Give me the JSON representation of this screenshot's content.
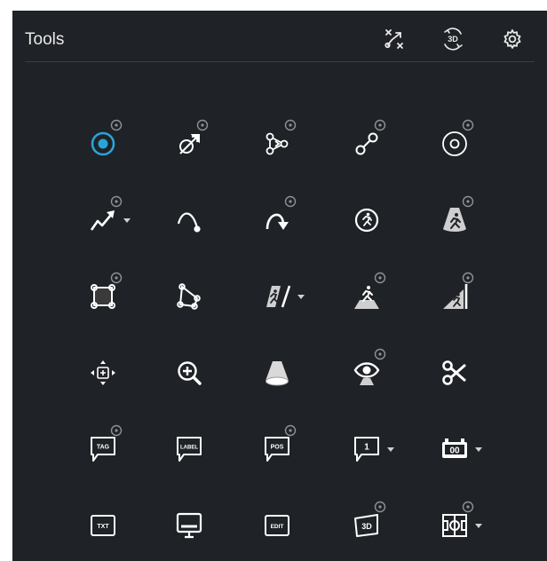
{
  "panel": {
    "title": "Tools",
    "header_icons": [
      "tactical-lines-icon",
      "rotate-3d-icon",
      "gear-icon"
    ]
  },
  "accent_color": "#2aa3d8",
  "tools": [
    {
      "name": "spotlight-point-tool",
      "icon": "target-circle-icon",
      "selected": true,
      "plus": true,
      "caret": false
    },
    {
      "name": "arrow-circle-tool",
      "icon": "circle-arrow-icon",
      "plus": true,
      "caret": false
    },
    {
      "name": "player-connection-tool",
      "icon": "triangle-connect-icon",
      "plus": true,
      "caret": false
    },
    {
      "name": "link-tool",
      "icon": "link-icon",
      "plus": true,
      "caret": false
    },
    {
      "name": "ring-tool",
      "icon": "ring-icon",
      "plus": true,
      "caret": false
    },
    {
      "name": "freehand-arrow-tool",
      "icon": "zigzag-arrow-icon",
      "plus": true,
      "caret": true
    },
    {
      "name": "curve-tool",
      "icon": "curve-icon",
      "plus": false,
      "caret": false
    },
    {
      "name": "curved-arrow-tool",
      "icon": "curved-arrow-icon",
      "plus": true,
      "caret": false
    },
    {
      "name": "player-circle-tool",
      "icon": "runner-circle-icon",
      "plus": false,
      "caret": false
    },
    {
      "name": "player-spotlight-tool",
      "icon": "runner-spotlight-icon",
      "plus": true,
      "caret": false
    },
    {
      "name": "rectangle-area-tool",
      "icon": "rectangle-nodes-icon",
      "plus": true,
      "caret": false
    },
    {
      "name": "polygon-area-tool",
      "icon": "polygon-icon",
      "plus": false,
      "caret": false
    },
    {
      "name": "player-wall-tool",
      "icon": "runner-wall-icon",
      "plus": false,
      "caret": true
    },
    {
      "name": "player-floor-tool",
      "icon": "runner-floor-icon",
      "plus": true,
      "caret": false
    },
    {
      "name": "player-ramp-tool",
      "icon": "runner-ramp-icon",
      "plus": true,
      "caret": false
    },
    {
      "name": "move-tool",
      "icon": "move-cross-icon",
      "plus": false,
      "caret": false
    },
    {
      "name": "zoom-tool",
      "icon": "zoom-in-icon",
      "plus": false,
      "caret": false
    },
    {
      "name": "spotlight-cone-tool",
      "icon": "spotlight-cone-icon",
      "plus": false,
      "caret": false
    },
    {
      "name": "vision-tool",
      "icon": "eye-icon",
      "plus": true,
      "caret": false
    },
    {
      "name": "cut-tool",
      "icon": "scissors-icon",
      "plus": false,
      "caret": false
    },
    {
      "name": "tag-tool",
      "icon": "tag-bubble-icon",
      "label": "TAG",
      "plus": true,
      "caret": false
    },
    {
      "name": "label-tool",
      "icon": "label-bubble-icon",
      "label": "LABEL",
      "plus": false,
      "caret": false
    },
    {
      "name": "pos-tool",
      "icon": "pos-bubble-icon",
      "label": "POS",
      "plus": true,
      "caret": false
    },
    {
      "name": "number-tool",
      "icon": "number-bubble-icon",
      "label": "1",
      "plus": false,
      "caret": true
    },
    {
      "name": "scoreboard-tool",
      "icon": "scoreboard-icon",
      "label": "00",
      "plus": false,
      "caret": true
    },
    {
      "name": "text-tool",
      "icon": "text-box-icon",
      "label": "TXT",
      "plus": false,
      "caret": false
    },
    {
      "name": "screen-tool",
      "icon": "monitor-icon",
      "plus": false,
      "caret": false
    },
    {
      "name": "edit-tool",
      "icon": "edit-box-icon",
      "label": "EDIT",
      "plus": false,
      "caret": false
    },
    {
      "name": "3d-text-tool",
      "icon": "3d-box-icon",
      "label": "3D",
      "plus": true,
      "caret": false
    },
    {
      "name": "field-tool",
      "icon": "field-icon",
      "plus": true,
      "caret": true
    }
  ]
}
